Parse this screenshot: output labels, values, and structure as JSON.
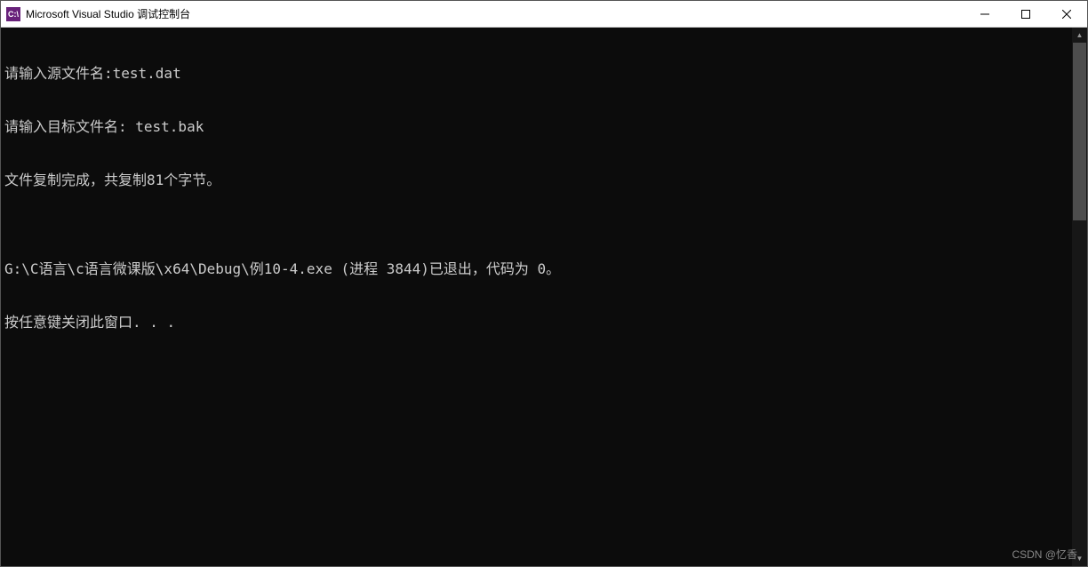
{
  "titlebar": {
    "icon_text": "C:\\",
    "title": "Microsoft Visual Studio 调试控制台"
  },
  "console": {
    "lines": [
      "请输入源文件名:test.dat",
      "请输入目标文件名: test.bak",
      "文件复制完成，共复制81个字节。",
      "",
      "G:\\C语言\\c语言微课版\\x64\\Debug\\例10-4.exe (进程 3844)已退出，代码为 0。",
      "按任意键关闭此窗口. . ."
    ]
  },
  "watermark": "CSDN @忆香"
}
